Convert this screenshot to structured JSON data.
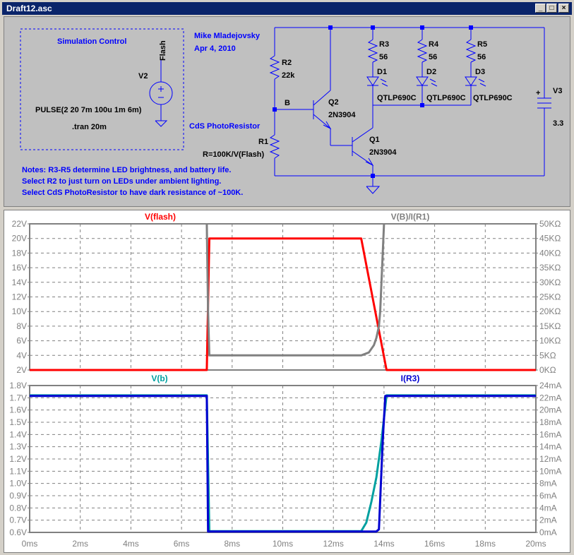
{
  "window": {
    "title": "Draft12.asc",
    "btn_min": "_",
    "btn_max": "□",
    "btn_close": "×"
  },
  "schematic": {
    "sim_control": "Simulation Control",
    "author": "Mike Mladejovsky",
    "date": "Apr 4, 2010",
    "flash_label": "Flash",
    "v2": "V2",
    "pulse": "PULSE(2 20 7m 100u 1m 6m)",
    "tran": ".tran 20m",
    "cds": "CdS PhotoResistor",
    "r2": "R2",
    "r2_val": "22k",
    "node_b": "B",
    "r1": "R1",
    "r1_val": "R=100K/V(Flash)",
    "q2": "Q2",
    "q2_model": "2N3904",
    "q1": "Q1",
    "q1_model": "2N3904",
    "r3": "R3",
    "r3_val": "56",
    "r4": "R4",
    "r4_val": "56",
    "r5": "R5",
    "r5_val": "56",
    "d1": "D1",
    "d1_model": "QTLP690C",
    "d2": "D2",
    "d2_model": "QTLP690C",
    "d3": "D3",
    "d3_model": "QTLP690C",
    "v3": "V3",
    "v3_val": "3.3",
    "plus": "+",
    "notes": [
      "Notes: R3-R5 determine LED brightness, and battery life.",
      "Select R2 to just turn on LEDs under ambient lighting.",
      "Select CdS PhotoResistor to have dark resistance of ~100K."
    ]
  },
  "chart_data": [
    {
      "type": "line",
      "x_unit": "ms",
      "xlim": [
        0,
        20
      ],
      "xticks": [
        "0ms",
        "2ms",
        "4ms",
        "6ms",
        "8ms",
        "10ms",
        "12ms",
        "14ms",
        "16ms",
        "18ms",
        "20ms"
      ],
      "left_axis": {
        "ylim": [
          2,
          22
        ],
        "ticks": [
          "2V",
          "4V",
          "6V",
          "8V",
          "10V",
          "12V",
          "14V",
          "16V",
          "18V",
          "20V",
          "22V"
        ]
      },
      "right_axis": {
        "ylim": [
          0,
          50
        ],
        "ticks": [
          "0KΩ",
          "5KΩ",
          "10KΩ",
          "15KΩ",
          "20KΩ",
          "25KΩ",
          "30KΩ",
          "35KΩ",
          "40KΩ",
          "45KΩ",
          "50KΩ"
        ]
      },
      "grid": true,
      "series": [
        {
          "name": "V(flash)",
          "axis": "left",
          "color": "#ff0000",
          "x": [
            0,
            7,
            7.1,
            13.1,
            14.1,
            20
          ],
          "y": [
            2,
            2,
            20,
            20,
            2,
            2
          ]
        },
        {
          "name": "V(B)/I(R1)",
          "axis": "right",
          "color": "#808080",
          "x": [
            7,
            7.05,
            7.1,
            13.1,
            13.4,
            13.6,
            13.7,
            13.8,
            13.85,
            13.9,
            14.0
          ],
          "y": [
            50,
            20,
            5,
            5,
            6,
            8.5,
            11,
            15,
            20,
            30,
            50
          ]
        }
      ]
    },
    {
      "type": "line",
      "x_unit": "ms",
      "xlim": [
        0,
        20
      ],
      "xticks": [
        "0ms",
        "2ms",
        "4ms",
        "6ms",
        "8ms",
        "10ms",
        "12ms",
        "14ms",
        "16ms",
        "18ms",
        "20ms"
      ],
      "left_axis": {
        "ylim": [
          0.6,
          1.8
        ],
        "ticks": [
          "0.6V",
          "0.7V",
          "0.8V",
          "0.9V",
          "1.0V",
          "1.1V",
          "1.2V",
          "1.3V",
          "1.4V",
          "1.5V",
          "1.6V",
          "1.7V",
          "1.8V"
        ]
      },
      "right_axis": {
        "ylim": [
          0,
          24
        ],
        "ticks": [
          "0mA",
          "2mA",
          "4mA",
          "6mA",
          "8mA",
          "10mA",
          "12mA",
          "14mA",
          "16mA",
          "18mA",
          "20mA",
          "22mA",
          "24mA"
        ]
      },
      "grid": true,
      "series": [
        {
          "name": "V(b)",
          "axis": "left",
          "color": "#00a0a0",
          "x": [
            0,
            7,
            7.1,
            13.1,
            13.3,
            13.5,
            13.7,
            13.9,
            14.1,
            20
          ],
          "y": [
            1.72,
            1.72,
            0.61,
            0.61,
            0.68,
            0.85,
            1.05,
            1.35,
            1.72,
            1.72
          ]
        },
        {
          "name": "I(R3)",
          "axis": "right",
          "color": "#0000d0",
          "x": [
            0,
            7,
            7.05,
            13.7,
            13.8,
            13.95,
            14.05,
            20
          ],
          "y": [
            22.3,
            22.3,
            0.15,
            0.15,
            0.5,
            15,
            22.3,
            22.3
          ]
        }
      ]
    }
  ]
}
